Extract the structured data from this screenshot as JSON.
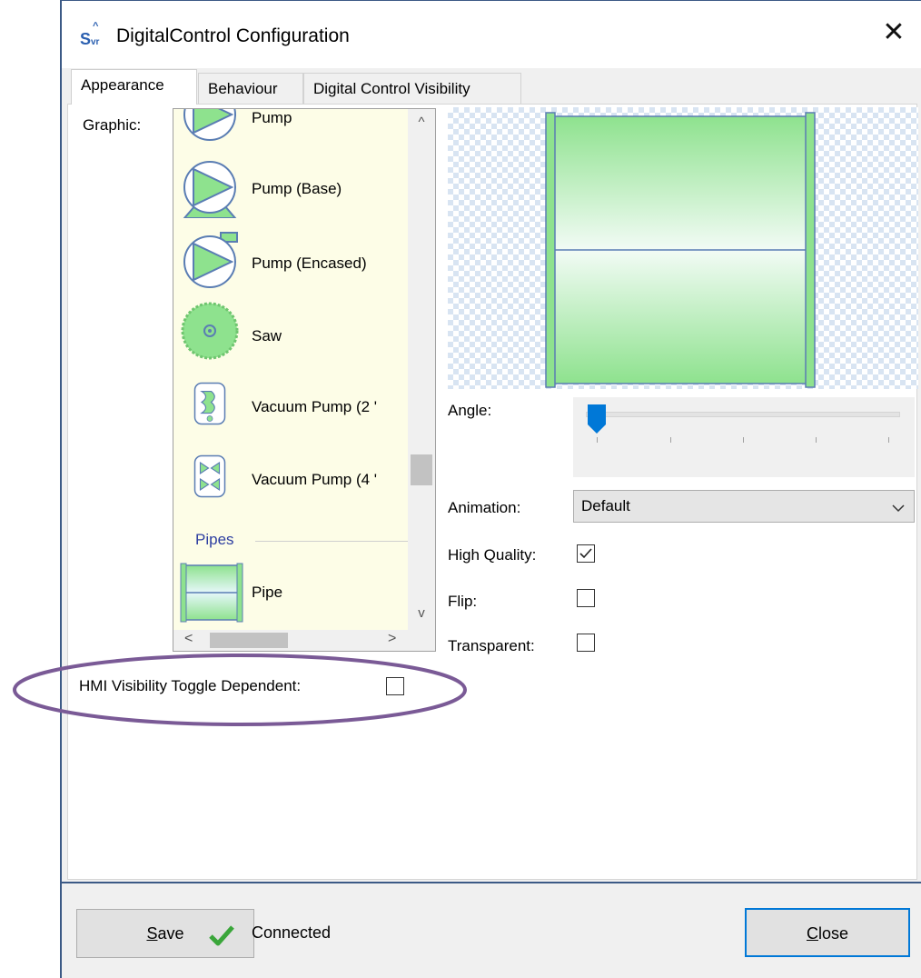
{
  "window": {
    "icon_text": "Svr",
    "title": "DigitalControl Configuration",
    "close_symbol": "✕"
  },
  "tabs": [
    {
      "label": "Appearance",
      "active": true
    },
    {
      "label": "Behaviour",
      "active": false
    },
    {
      "label": "Digital Control Visibility",
      "active": false
    }
  ],
  "appearance": {
    "graphic_label": "Graphic:",
    "graphic_list": {
      "items": [
        {
          "label": "Pump",
          "icon": "pump-icon"
        },
        {
          "label": "Pump (Base)",
          "icon": "pump-base-icon"
        },
        {
          "label": "Pump (Encased)",
          "icon": "pump-encased-icon"
        },
        {
          "label": "Saw",
          "icon": "saw-icon"
        },
        {
          "label": "Vacuum Pump (2 '",
          "icon": "vacuum-pump-icon"
        },
        {
          "label": "Vacuum Pump (4 '",
          "icon": "vacuum-pump-icon"
        }
      ],
      "group_header": "Pipes",
      "pipe_item": {
        "label": "Pipe",
        "icon": "pipe-icon",
        "selected": true
      },
      "scroll_up": "^",
      "scroll_down": "v",
      "scroll_left": "<",
      "scroll_right": ">"
    },
    "angle_label": "Angle:",
    "angle_value_fraction": 0.0,
    "animation_label": "Animation:",
    "animation_value": "Default",
    "high_quality_label": "High Quality:",
    "high_quality_checked": true,
    "flip_label": "Flip:",
    "flip_checked": false,
    "transparent_label": "Transparent:",
    "transparent_checked": false,
    "hmi_label": "HMI Visibility Toggle Dependent:",
    "hmi_checked": false
  },
  "footer": {
    "save_label": "Save",
    "status_text": "Connected",
    "close_label": "Close"
  },
  "colors": {
    "accent_blue": "#0078d7",
    "pipe_green": "#8ee28e",
    "annotation_purple": "#7a5a96"
  }
}
